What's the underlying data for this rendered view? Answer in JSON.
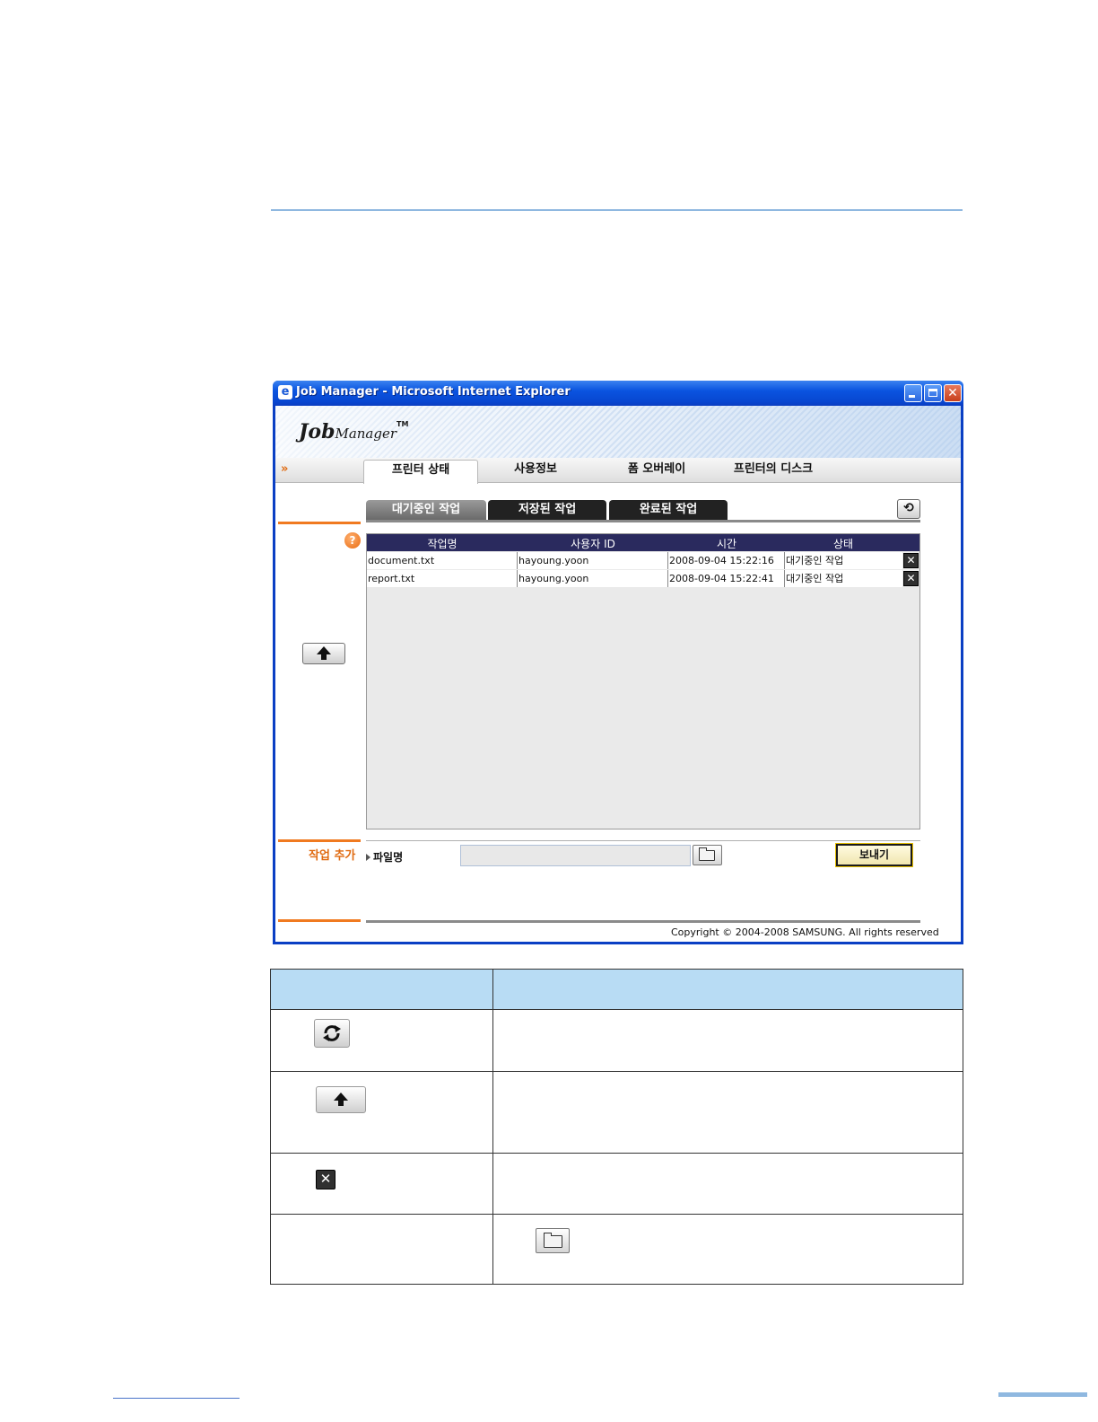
{
  "window": {
    "title": "Job Manager - Microsoft Internet Explorer",
    "ie_icon": "ie-icon",
    "close_symbol": "✕"
  },
  "app": {
    "logo_job": "Job",
    "logo_manager": "Manager",
    "logo_tm": "TM"
  },
  "nav": {
    "arrow": "»",
    "tabs": [
      {
        "label": "프린터 상태",
        "active": true
      },
      {
        "label": "사용정보",
        "active": false
      },
      {
        "label": "폼 오버레이",
        "active": false
      },
      {
        "label": "프린터의 디스크",
        "active": false
      }
    ]
  },
  "subtabs": [
    {
      "label": "대기중인 작업",
      "active": true
    },
    {
      "label": "저장된 작업",
      "active": false
    },
    {
      "label": "완료된 작업",
      "active": false
    }
  ],
  "help_symbol": "?",
  "refresh_symbol": "⟲",
  "grid": {
    "headers": [
      "작업명",
      "사용자 ID",
      "시간",
      "상태"
    ],
    "rows": [
      {
        "name": "document.txt",
        "user": "hayoung.yoon",
        "time": "2008-09-04 15:22:16",
        "status": "대기중인 작업"
      },
      {
        "name": "report.txt",
        "user": "hayoung.yoon",
        "time": "2008-09-04 15:22:41",
        "status": "대기중인 작업"
      }
    ],
    "delete_symbol": "✕"
  },
  "add_job": {
    "section_label": "작업 추가",
    "filename_label": "파일명",
    "filename_value": "",
    "send_label": "보내기"
  },
  "footer": {
    "copyright": "Copyright © 2004-2008 SAMSUNG. All rights reserved"
  },
  "legend_rows": [
    {
      "icon": "refresh-icon"
    },
    {
      "icon": "up-arrow-icon"
    },
    {
      "icon": "delete-icon"
    },
    {
      "icon": "folder-icon"
    }
  ],
  "colors": {
    "titlebar": "#0a54e0",
    "accent_orange": "#f07a20",
    "grid_header": "#2a2a5e",
    "table_header": "#b8dcf4",
    "rule_blue": "#8fb8e0"
  }
}
